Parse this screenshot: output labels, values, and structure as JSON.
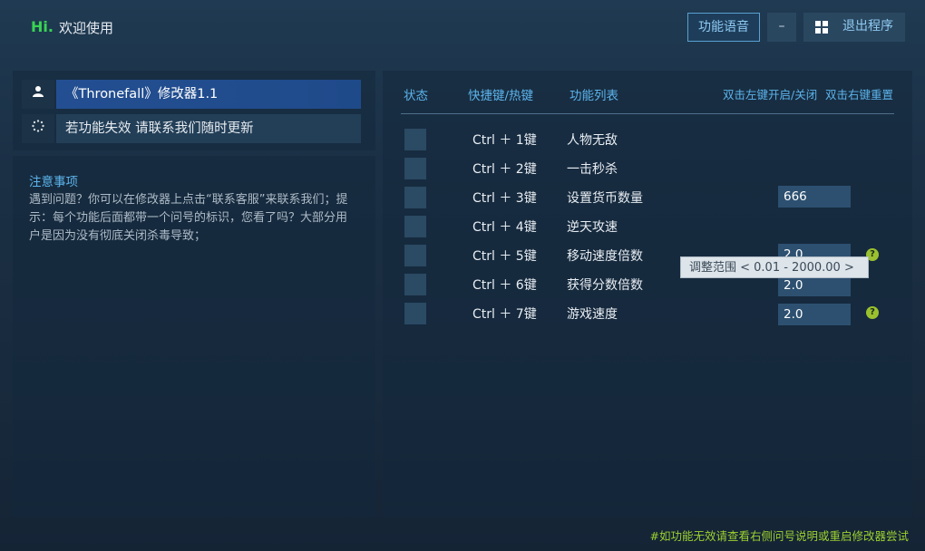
{
  "header": {
    "hi": "Hi.",
    "welcome": "欢迎使用",
    "voice_button": "功能语音",
    "minimize_button": "–",
    "exit_button": "退出程序"
  },
  "left": {
    "title_item": "《Thronefall》修改器1.1",
    "update_item": "若功能失效 请联系我们随时更新",
    "notice_title": "注意事项",
    "notice_body": "遇到问题？你可以在修改器上点击“联系客服”来联系我们；提示：每个功能后面都带一个问号的标识，您看了吗？大部分用户是因为没有彻底关闭杀毒导致；"
  },
  "table": {
    "headers": {
      "status": "状态",
      "hotkey": "快捷键/热键",
      "features": "功能列表",
      "double_left": "双击左键开启/关闭",
      "double_right": "双击右键重置"
    },
    "rows": [
      {
        "key": "Ctrl ＋ 1键",
        "name": "人物无敌"
      },
      {
        "key": "Ctrl ＋ 2键",
        "name": "一击秒杀"
      },
      {
        "key": "Ctrl ＋ 3键",
        "name": "设置货币数量",
        "value": "666"
      },
      {
        "key": "Ctrl ＋ 4键",
        "name": "逆天攻速"
      },
      {
        "key": "Ctrl ＋ 5键",
        "name": "移动速度倍数",
        "value": "2.0"
      },
      {
        "key": "Ctrl ＋ 6键",
        "name": "获得分数倍数",
        "value": "2.0"
      },
      {
        "key": "Ctrl ＋ 7键",
        "name": "游戏速度",
        "value": "2.0"
      }
    ]
  },
  "tooltip": "调整范围 < 0.01 - 2000.00 >",
  "footer": "#如功能无效请查看右侧问号说明或重启修改器尝试",
  "colors": {
    "accent_green": "#39d353",
    "accent_blue": "#5cb4ec",
    "selected_row": "#234f92",
    "help_badge": "#9bc22e"
  }
}
